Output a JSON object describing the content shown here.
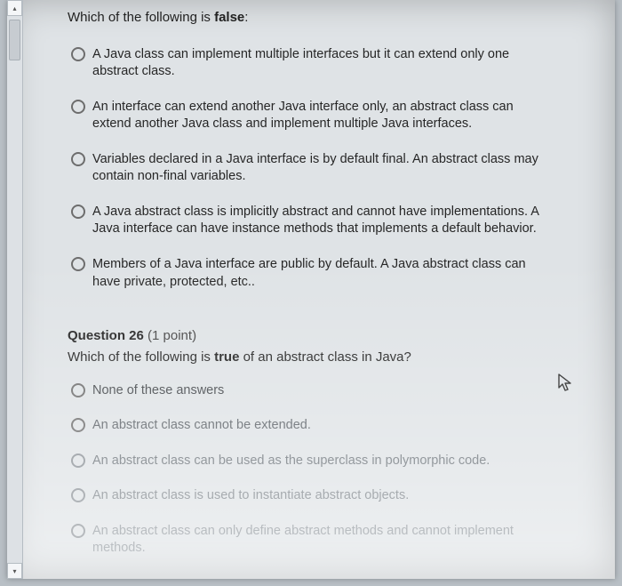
{
  "q1": {
    "prompt_prefix": "Which of the following is ",
    "prompt_bold": "false",
    "prompt_suffix": ":",
    "options": [
      "A Java class can implement multiple interfaces but it can extend only one abstract class.",
      "An interface can extend another Java interface only, an abstract class can extend another Java class and implement multiple Java interfaces.",
      "Variables declared in a Java interface is by default final. An abstract class may contain non-final variables.",
      "A Java abstract class is implicitly abstract and cannot have implementations. A Java interface can have instance methods that implements a default behavior.",
      "Members of a Java interface are public by default. A Java abstract class can have private, protected, etc.."
    ]
  },
  "q2": {
    "header_label": "Question 26",
    "points": "(1 point)",
    "prompt_prefix": "Which of the following is ",
    "prompt_bold": "true",
    "prompt_suffix": " of an abstract class in Java?",
    "options": [
      "None of these answers",
      "An abstract class cannot be extended.",
      "An abstract class can be used as the superclass in polymorphic code.",
      "An abstract class is used to instantiate abstract objects.",
      "An abstract class can only define abstract methods and cannot implement methods."
    ]
  }
}
